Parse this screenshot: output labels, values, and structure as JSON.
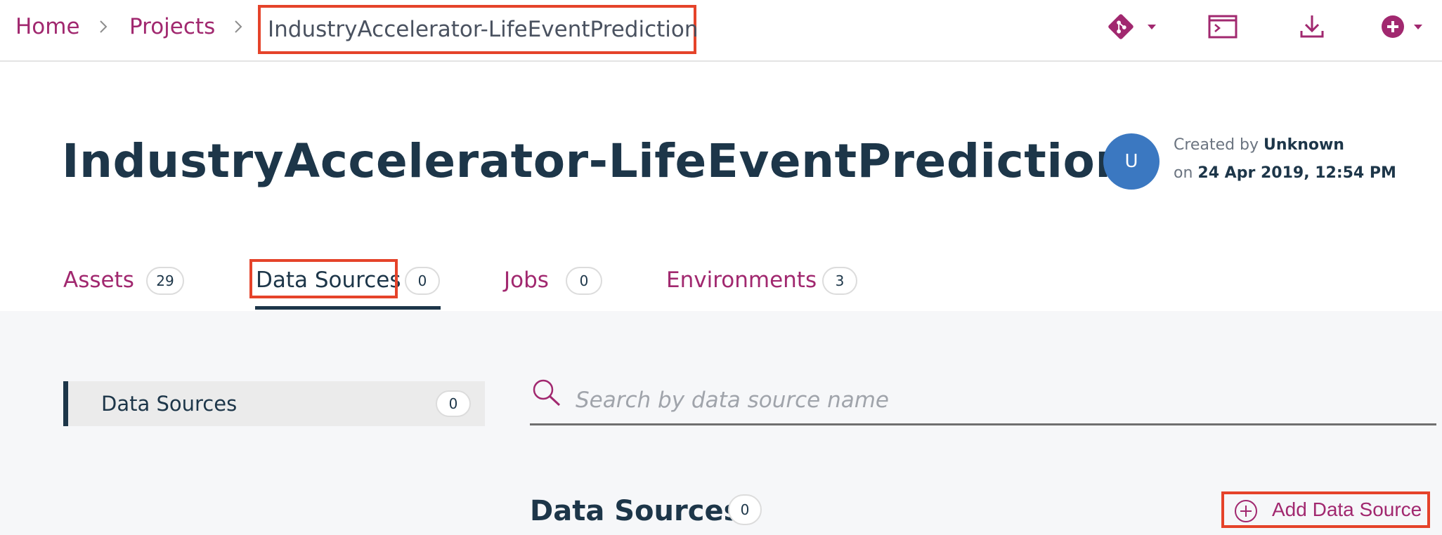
{
  "breadcrumb": {
    "home": "Home",
    "projects": "Projects",
    "current": "IndustryAccelerator-LifeEventPrediction"
  },
  "toolbar": {
    "icons": [
      "git-icon",
      "terminal-icon",
      "download-icon",
      "add-circle-icon"
    ],
    "accent_color": "#a1286f"
  },
  "project": {
    "title": "IndustryAccelerator-LifeEventPrediction",
    "avatar_letter": "U",
    "created_by_label": "Created by",
    "created_by_value": "Unknown",
    "on_label": "on",
    "created_on": "24 Apr 2019, 12:54 PM"
  },
  "tabs": [
    {
      "label": "Assets",
      "count": "29"
    },
    {
      "label": "Data Sources",
      "count": "0"
    },
    {
      "label": "Jobs",
      "count": "0"
    },
    {
      "label": "Environments",
      "count": "3"
    }
  ],
  "active_tab": "Data Sources",
  "sidebar": {
    "items": [
      {
        "label": "Data Sources",
        "count": "0"
      }
    ]
  },
  "search": {
    "placeholder": "Search by data source name",
    "value": ""
  },
  "section": {
    "title": "Data Sources",
    "count": "0",
    "add_label": "Add Data Source"
  },
  "highlight_color": "#e5432a"
}
